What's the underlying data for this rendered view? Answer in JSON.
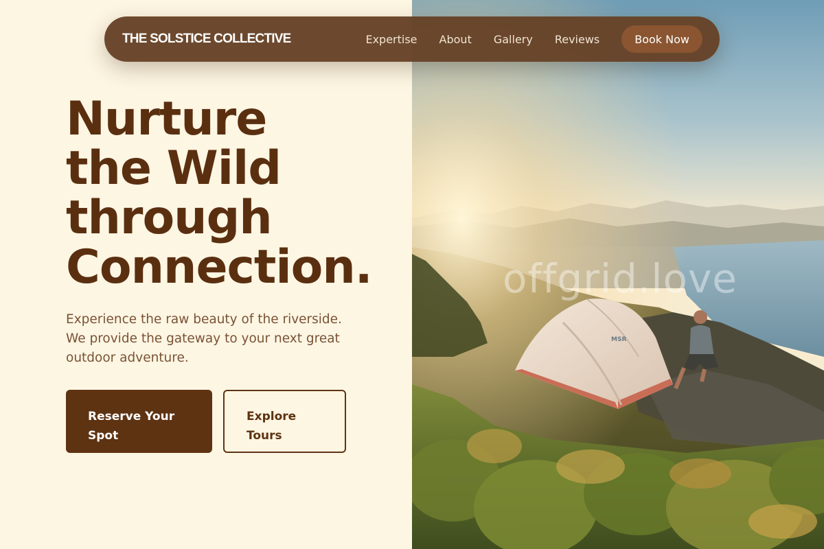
{
  "nav": {
    "brand": "THE SOLSTICE COLLECTIVE",
    "links": [
      "Expertise",
      "About",
      "Gallery",
      "Reviews"
    ],
    "cta": "Book Now"
  },
  "hero": {
    "headline": [
      "Nurture",
      "the Wild",
      "through",
      "Connection."
    ],
    "description": "Experience the raw beauty of the riverside. We provide the gateway to your next great outdoor adventure.",
    "primary_button": "Reserve Your Spot",
    "secondary_button": "Explore Tours"
  },
  "image": {
    "watermark": "offgrid.love",
    "tent_logo": "MSR"
  },
  "colors": {
    "background": "#fdf6e3",
    "nav_background": "#664226",
    "brand_brown": "#5a2f10",
    "cta": "#8a5530"
  }
}
